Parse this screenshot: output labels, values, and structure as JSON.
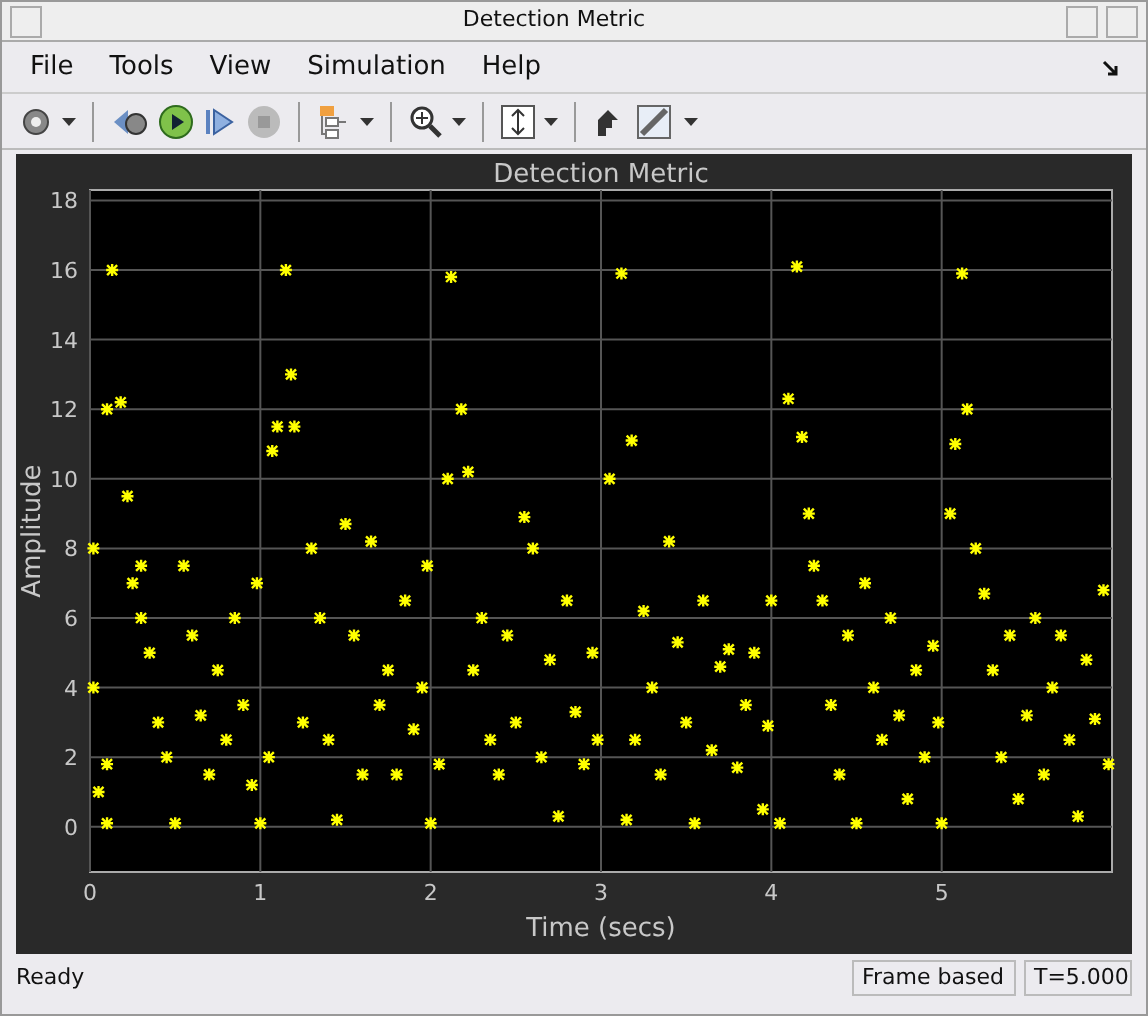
{
  "window": {
    "title": "Detection Metric"
  },
  "menu": [
    "File",
    "Tools",
    "View",
    "Simulation",
    "Help"
  ],
  "plot": {
    "chart_data": {
      "type": "scatter",
      "title": "Detection Metric",
      "xlabel": "Time (secs)",
      "ylabel": "Amplitude",
      "xlim": [
        0,
        6
      ],
      "ylim": [
        -1.3,
        18.3
      ],
      "xticks": [
        0,
        1,
        2,
        3,
        4,
        5
      ],
      "yticks": [
        0,
        2,
        4,
        6,
        8,
        10,
        12,
        14,
        16,
        18
      ],
      "grid": true,
      "series": [
        {
          "color": "#ffff00",
          "x": [
            0.02,
            0.02,
            0.05,
            0.1,
            0.1,
            0.13,
            0.1,
            0.18,
            0.22,
            0.25,
            0.3,
            0.3,
            0.35,
            0.4,
            0.45,
            0.5,
            0.55,
            0.6,
            0.65,
            0.7,
            0.75,
            0.8,
            0.85,
            0.9,
            0.95,
            0.98,
            1.0,
            1.05,
            1.07,
            1.1,
            1.15,
            1.18,
            1.2,
            1.25,
            1.3,
            1.35,
            1.4,
            1.45,
            1.5,
            1.55,
            1.6,
            1.65,
            1.7,
            1.75,
            1.8,
            1.85,
            1.9,
            1.95,
            1.98,
            2.0,
            2.05,
            2.1,
            2.12,
            2.18,
            2.22,
            2.25,
            2.3,
            2.35,
            2.4,
            2.45,
            2.5,
            2.55,
            2.6,
            2.65,
            2.7,
            2.75,
            2.8,
            2.85,
            2.9,
            2.95,
            2.98,
            3.05,
            3.12,
            3.18,
            3.15,
            3.2,
            3.25,
            3.3,
            3.35,
            3.4,
            3.45,
            3.5,
            3.55,
            3.6,
            3.65,
            3.7,
            3.75,
            3.8,
            3.85,
            3.9,
            3.95,
            3.98,
            4.0,
            4.05,
            4.1,
            4.15,
            4.18,
            4.22,
            4.25,
            4.3,
            4.35,
            4.4,
            4.45,
            4.5,
            4.55,
            4.6,
            4.65,
            4.7,
            4.75,
            4.8,
            4.85,
            4.9,
            4.95,
            4.98,
            5.0,
            5.05,
            5.08,
            5.12,
            5.15,
            5.2,
            5.25,
            5.3,
            5.35,
            5.4,
            5.45,
            5.5,
            5.55,
            5.6,
            5.65,
            5.7,
            5.75,
            5.8,
            5.85,
            5.9,
            5.95,
            5.98
          ],
          "values": [
            4,
            8,
            1,
            0.1,
            1.8,
            16,
            12,
            12.2,
            9.5,
            7,
            7.5,
            6,
            5,
            3,
            2,
            0.1,
            7.5,
            5.5,
            3.2,
            1.5,
            4.5,
            2.5,
            6,
            3.5,
            1.2,
            7,
            0.1,
            2,
            10.8,
            11.5,
            16,
            13,
            11.5,
            3,
            8,
            6,
            2.5,
            0.2,
            8.7,
            5.5,
            1.5,
            8.2,
            3.5,
            4.5,
            1.5,
            6.5,
            2.8,
            4,
            7.5,
            0.1,
            1.8,
            10,
            15.8,
            12,
            10.2,
            4.5,
            6,
            2.5,
            1.5,
            5.5,
            3,
            8.9,
            8,
            2,
            4.8,
            0.3,
            6.5,
            3.3,
            1.8,
            5,
            2.5,
            10,
            15.9,
            11.1,
            0.2,
            2.5,
            6.2,
            4,
            1.5,
            8.2,
            5.3,
            3,
            0.1,
            6.5,
            2.2,
            4.6,
            5.1,
            1.7,
            3.5,
            5,
            0.5,
            2.9,
            6.5,
            0.1,
            12.3,
            16.1,
            11.2,
            9,
            7.5,
            6.5,
            3.5,
            1.5,
            5.5,
            0.1,
            7,
            4,
            2.5,
            6,
            3.2,
            0.8,
            4.5,
            2,
            5.2,
            3,
            0.1,
            9,
            11,
            15.9,
            12,
            8,
            6.7,
            4.5,
            2,
            5.5,
            0.8,
            3.2,
            6,
            1.5,
            4,
            5.5,
            2.5,
            0.3,
            4.8,
            3.1,
            6.8,
            1.8
          ]
        }
      ]
    }
  },
  "status_bar": {
    "message": "Ready",
    "mode": "Frame based",
    "time": "T=5.000"
  }
}
